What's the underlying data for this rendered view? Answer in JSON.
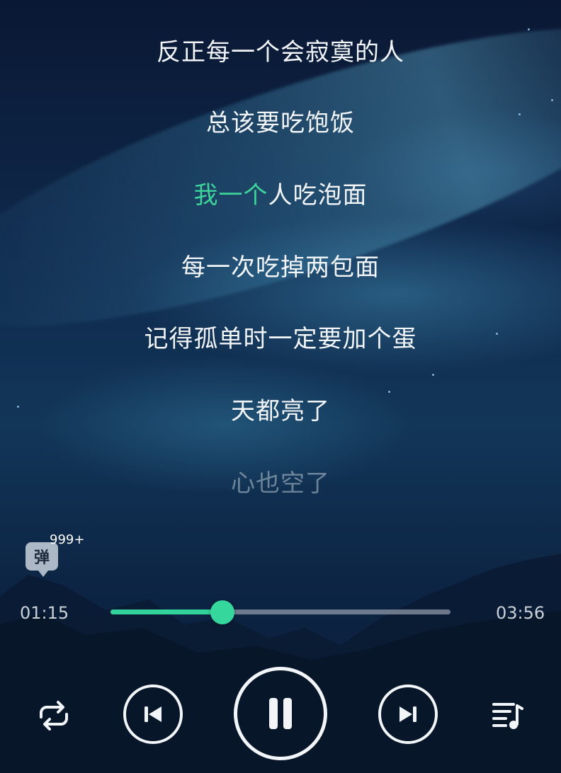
{
  "lyrics": {
    "lines": [
      {
        "text": "反正每一个会寂寞的人"
      },
      {
        "text": "总该要吃饱饭"
      },
      {
        "sung": "我一个",
        "rest": "人吃泡面"
      },
      {
        "text": "每一次吃掉两包面"
      },
      {
        "text": "记得孤单时一定要加个蛋"
      },
      {
        "text": "天都亮了"
      },
      {
        "text": "心也空了"
      }
    ],
    "highlight_color": "#3dd39a"
  },
  "danmu": {
    "label": "弹",
    "count": "999+"
  },
  "player": {
    "current_time": "01:15",
    "total_time": "03:56",
    "progress_fraction": 0.33,
    "accent_color": "#32d39a"
  },
  "controls": {
    "repeat": "repeat-icon",
    "previous": "skip-previous-icon",
    "play_pause": "pause-icon",
    "next": "skip-next-icon",
    "playlist": "playlist-icon"
  }
}
